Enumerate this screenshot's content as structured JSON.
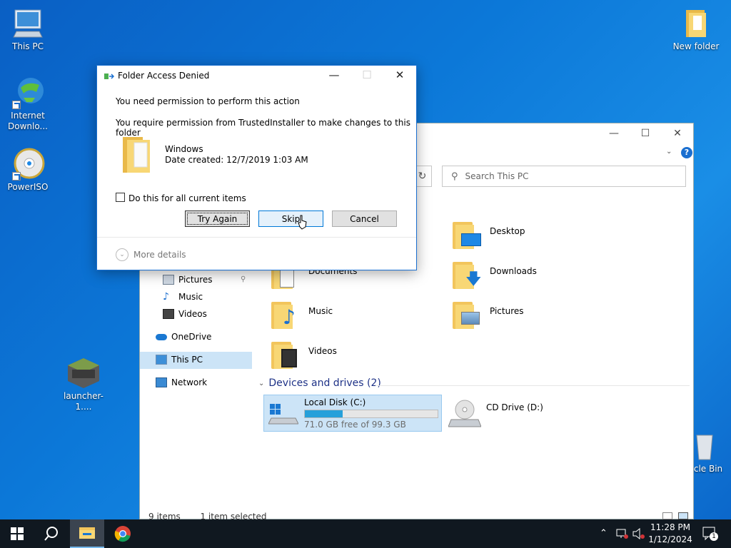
{
  "desktop": {
    "icons": [
      {
        "label": "This PC"
      },
      {
        "label": "Internet Downlo..."
      },
      {
        "label": "PowerISO"
      },
      {
        "label": "launcher-1...."
      },
      {
        "label": "New folder"
      },
      {
        "label": "cle Bin"
      }
    ]
  },
  "explorer": {
    "search_placeholder": "Search This PC",
    "nav": {
      "pictures": "Pictures",
      "music": "Music",
      "videos": "Videos",
      "onedrive": "OneDrive",
      "thispc": "This PC",
      "network": "Network"
    },
    "folders": {
      "desktop": "Desktop",
      "downloads": "Downloads",
      "documents": "Documents",
      "music": "Music",
      "pictures": "Pictures",
      "videos": "Videos"
    },
    "devices_header": "Devices and drives (2)",
    "drives": {
      "c_name": "Local Disk (C:)",
      "c_free": "71.0 GB free of 99.3 GB",
      "c_used_fraction": 0.285,
      "d_name": "CD Drive (D:)"
    },
    "status": {
      "items": "9 items",
      "selected": "1 item selected"
    }
  },
  "dialog": {
    "title": "Folder Access Denied",
    "line1": "You need permission to perform this action",
    "line2": "You require permission from TrustedInstaller to make changes to this folder",
    "folder_name": "Windows",
    "folder_date": "Date created: 12/7/2019 1:03 AM",
    "checkbox_label": "Do this for all current items",
    "buttons": {
      "try_again": "Try Again",
      "skip": "Skip",
      "cancel": "Cancel"
    },
    "more_details": "More details"
  },
  "taskbar": {
    "time": "11:28 PM",
    "date": "1/12/2024",
    "notification_count": "1"
  },
  "colors": {
    "accent": "#0078d7",
    "folder": "#f8d775",
    "drive_fill": "#26a0da"
  }
}
